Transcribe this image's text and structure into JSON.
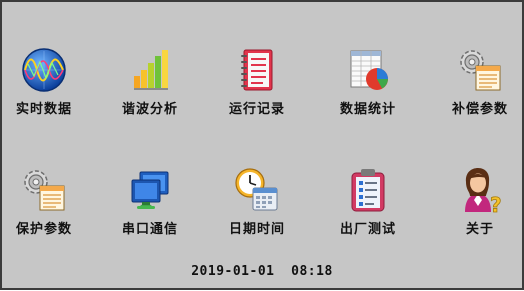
{
  "menu": {
    "row1": [
      {
        "label": "实时数据",
        "icon": "oscilloscope-globe-icon"
      },
      {
        "label": "谐波分析",
        "icon": "bar-chart-icon"
      },
      {
        "label": "运行记录",
        "icon": "notebook-icon"
      },
      {
        "label": "数据统计",
        "icon": "spreadsheet-pie-icon"
      },
      {
        "label": "补偿参数",
        "icon": "gear-document-icon"
      }
    ],
    "row2": [
      {
        "label": "保护参数",
        "icon": "gear-document-icon"
      },
      {
        "label": "串口通信",
        "icon": "monitors-icon"
      },
      {
        "label": "日期时间",
        "icon": "clock-calendar-icon"
      },
      {
        "label": "出厂测试",
        "icon": "clipboard-checklist-icon"
      },
      {
        "label": "关于",
        "icon": "user-help-icon"
      }
    ]
  },
  "status": {
    "datetime": "2019-01-01  08:18"
  },
  "colors": {
    "background": "#c6c6c6",
    "border": "#3b3b3b",
    "text": "#111111"
  }
}
